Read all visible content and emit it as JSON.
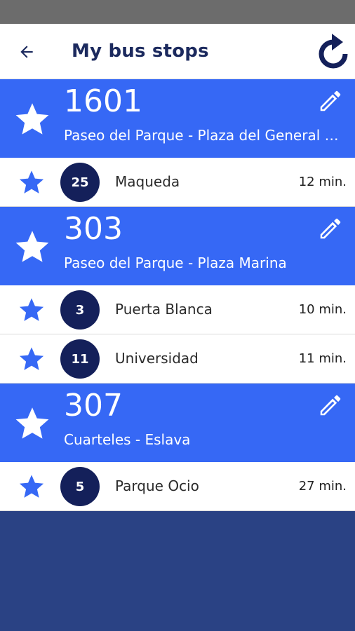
{
  "app_bar": {
    "title": "My bus stops",
    "back_icon": "arrow-left-icon",
    "refresh_icon": "refresh-icon"
  },
  "colors": {
    "primary": "#3668f5",
    "dark_navy": "#14205a",
    "background": "#2a4284",
    "title_text": "#1c2a5e"
  },
  "stops": [
    {
      "number": "1601",
      "name": "Paseo del Parque - Plaza del General Torrijos",
      "lines": [
        {
          "line": "25",
          "destination": "Maqueda",
          "eta": "12 min."
        }
      ]
    },
    {
      "number": "303",
      "name": "Paseo del Parque - Plaza Marina",
      "lines": [
        {
          "line": "3",
          "destination": "Puerta Blanca",
          "eta": "10 min."
        },
        {
          "line": "11",
          "destination": "Universidad",
          "eta": "11 min."
        }
      ]
    },
    {
      "number": "307",
      "name": "Cuarteles - Eslava",
      "lines": [
        {
          "line": "5",
          "destination": "Parque Ocio",
          "eta": "27 min."
        }
      ]
    }
  ]
}
